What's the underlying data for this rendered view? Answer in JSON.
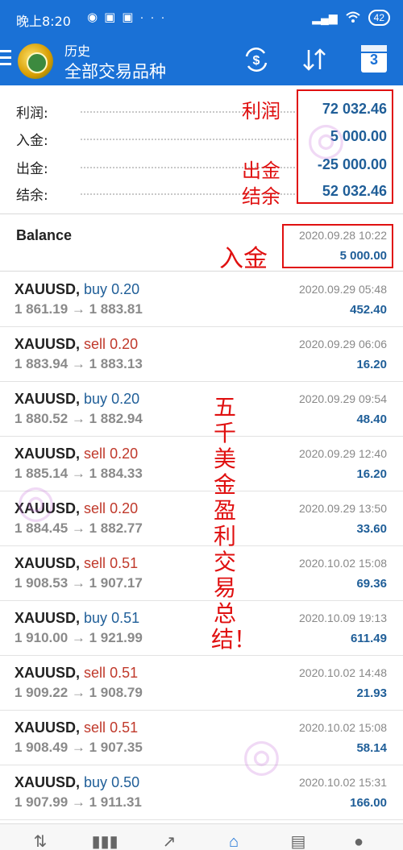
{
  "status_bar": {
    "time": "晚上8:20",
    "dots": "···",
    "battery": "42"
  },
  "appbar": {
    "subtitle": "历史",
    "title": "全部交易品种",
    "calendar_day": "3"
  },
  "summary": [
    {
      "label": "利润:",
      "value": "72 032.46"
    },
    {
      "label": "入金:",
      "value": "5 000.00"
    },
    {
      "label": "出金:",
      "value": "-25 000.00"
    },
    {
      "label": "结余:",
      "value": "52 032.46"
    }
  ],
  "balance": {
    "label": "Balance",
    "date": "2020.09.28 10:22",
    "amount": "5 000.00"
  },
  "deals": [
    {
      "symbol": "XAUUSD,",
      "dir": "buy",
      "volume": "0.20",
      "prices": "1 861.19 → 1 883.81",
      "date": "2020.09.29 05:48",
      "profit": "452.40"
    },
    {
      "symbol": "XAUUSD,",
      "dir": "sell",
      "volume": "0.20",
      "prices": "1 883.94 → 1 883.13",
      "date": "2020.09.29 06:06",
      "profit": "16.20"
    },
    {
      "symbol": "XAUUSD,",
      "dir": "buy",
      "volume": "0.20",
      "prices": "1 880.52 → 1 882.94",
      "date": "2020.09.29 09:54",
      "profit": "48.40"
    },
    {
      "symbol": "XAUUSD,",
      "dir": "sell",
      "volume": "0.20",
      "prices": "1 885.14 → 1 884.33",
      "date": "2020.09.29 12:40",
      "profit": "16.20"
    },
    {
      "symbol": "XAUUSD,",
      "dir": "sell",
      "volume": "0.20",
      "prices": "1 884.45 → 1 882.77",
      "date": "2020.09.29 13:50",
      "profit": "33.60"
    },
    {
      "symbol": "XAUUSD,",
      "dir": "sell",
      "volume": "0.51",
      "prices": "1 908.53 → 1 907.17",
      "date": "2020.10.02 15:08",
      "profit": "69.36"
    },
    {
      "symbol": "XAUUSD,",
      "dir": "buy",
      "volume": "0.51",
      "prices": "1 910.00 → 1 921.99",
      "date": "2020.10.09 19:13",
      "profit": "611.49"
    },
    {
      "symbol": "XAUUSD,",
      "dir": "sell",
      "volume": "0.51",
      "prices": "1 909.22 → 1 908.79",
      "date": "2020.10.02 14:48",
      "profit": "21.93"
    },
    {
      "symbol": "XAUUSD,",
      "dir": "sell",
      "volume": "0.51",
      "prices": "1 908.49 → 1 907.35",
      "date": "2020.10.02 15:08",
      "profit": "58.14"
    },
    {
      "symbol": "XAUUSD,",
      "dir": "buy",
      "volume": "0.50",
      "prices": "1 907.99 → 1 911.31",
      "date": "2020.10.02 15:31",
      "profit": "166.00"
    }
  ],
  "annotations": {
    "profit": "利润",
    "withdrawal": "出金",
    "balance": "结余",
    "deposit": "入金",
    "vertical_text": "五千美金盈利交易总结！"
  },
  "colors": {
    "primary": "#1a71d6",
    "value_blue": "#1f5e98",
    "sell_red": "#c0392b",
    "annotation_red": "#e01010"
  },
  "bottom_nav": [
    "quotes-icon",
    "chart-icon",
    "trade-icon",
    "history-icon",
    "news-icon",
    "chat-icon"
  ]
}
